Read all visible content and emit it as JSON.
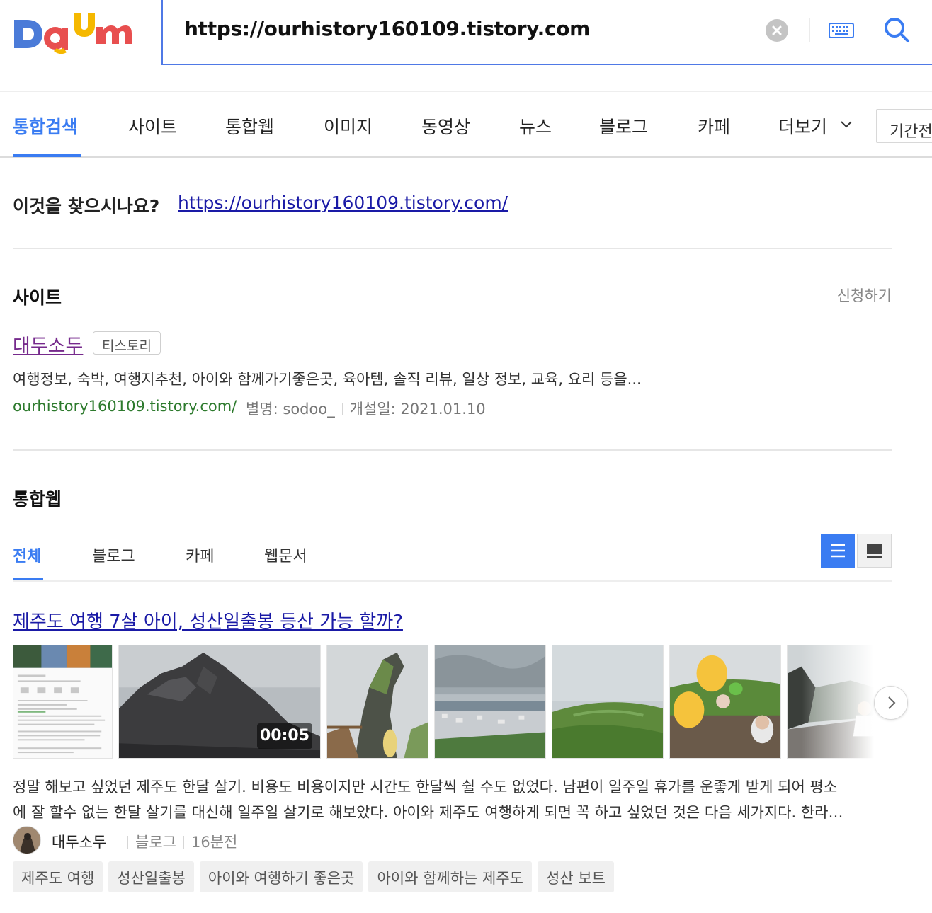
{
  "header": {
    "logo_text": "Daum",
    "search_value": "https://ourhistory160109.tistory.com",
    "brand_colors": {
      "d": "#4b7bd8",
      "a": "#e84f4f",
      "u": "#f5b800",
      "m": "#e84f4f"
    }
  },
  "nav": {
    "items": [
      {
        "label": "통합검색",
        "active": true
      },
      {
        "label": "사이트"
      },
      {
        "label": "통합웹"
      },
      {
        "label": "이미지"
      },
      {
        "label": "동영상"
      },
      {
        "label": "뉴스"
      },
      {
        "label": "블로그"
      },
      {
        "label": "카페"
      },
      {
        "label": "더보기"
      }
    ],
    "period_label": "기간전",
    "accent": "#3a7cf2"
  },
  "suggestion": {
    "prompt": "이것을 찾으시나요?",
    "link": "https://ourhistory160109.tistory.com/"
  },
  "site_section": {
    "title": "사이트",
    "apply_label": "신청하기",
    "name": "대두소두",
    "badge": "티스토리",
    "description": "여행정보, 숙박, 여행지추천, 아이와 함께가기좋은곳, 육아템, 솔직 리뷰, 일상 정보, 교육, 요리 등을...",
    "url": "ourhistory160109.tistory.com/",
    "alias": "별명: sodoo_",
    "opened": "개설일: 2021.01.10"
  },
  "web_section": {
    "title": "통합웹",
    "tabs": [
      {
        "label": "전체",
        "active": true
      },
      {
        "label": "블로그"
      },
      {
        "label": "카페"
      },
      {
        "label": "웹문서"
      }
    ],
    "view_mode": "list"
  },
  "result": {
    "title": "제주도 여행 7살 아이, 성산일출봉 등산 가능 할까?",
    "video_duration": "00:05",
    "desc_line1": "정말 해보고 싶었던 제주도 한달 살기. 비용도 비용이지만 시간도 한달씩 쉴 수도 없었다. 남편이 일주일 휴가를 운좋게 받게 되어 평소",
    "desc_line2": "에 잘 할수 없는 한달 살기를 대신해 일주일 살기로 해보았다. 아이와 제주도 여행하게 되면 꼭 하고 싶었던 것은 다음 세가지다. 한라…",
    "author": "대두소두",
    "source": "블로그",
    "time": "16분전",
    "tags": [
      "제주도 여행",
      "성산일출봉",
      "아이와 여행하기 좋은곳",
      "아이와 함께하는 제주도",
      "성산 보트"
    ]
  }
}
